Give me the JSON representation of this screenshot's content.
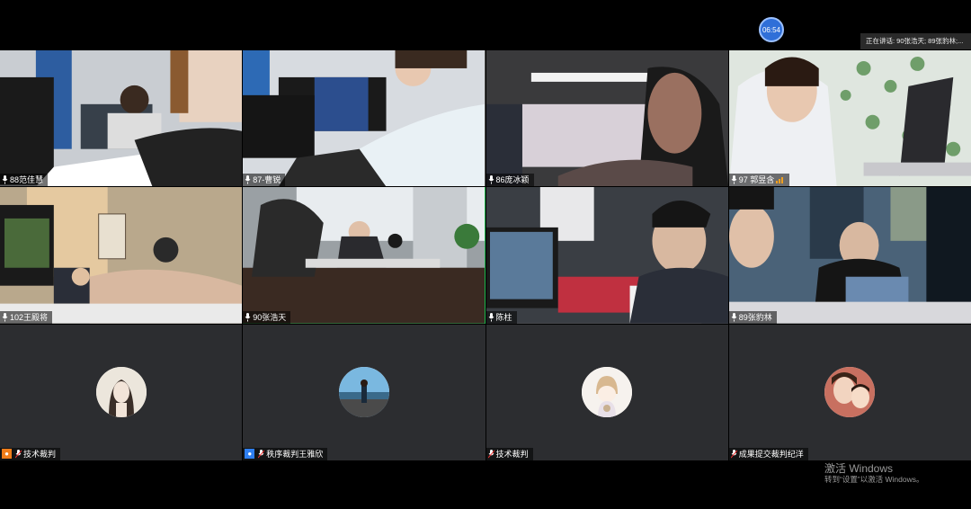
{
  "meeting": {
    "timer": "06:54",
    "speaking_now": "正在讲话: 90张浩天; 89张豹林;..."
  },
  "tiles": [
    {
      "name": "88范佳慧"
    },
    {
      "name": "87-曹锐"
    },
    {
      "name": "86庞冰颖"
    },
    {
      "name": "97 郭昱含"
    },
    {
      "name": "102王殿将"
    },
    {
      "name": "90张浩天"
    },
    {
      "name": "陈柱"
    },
    {
      "name": "89张豹林"
    },
    {
      "name": "技术裁判"
    },
    {
      "name": "秩序裁判王雅欣"
    },
    {
      "name": "技术裁判"
    },
    {
      "name": "成果提交裁判纪洋"
    }
  ],
  "watermark": {
    "line1": "激活 Windows",
    "line2": "转到“设置”以激活 Windows。"
  }
}
